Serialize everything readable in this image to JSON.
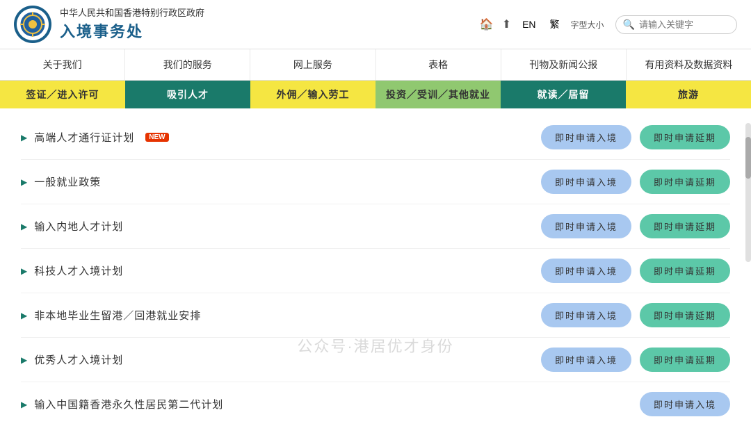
{
  "header": {
    "logo_emoji": "🦁",
    "gov_name": "中华人民共和国香港特别行政区政府",
    "dept_name": "入境事务处",
    "home_icon": "🏠",
    "share_icon": "⬆",
    "lang_en": "EN",
    "lang_tc": "繁",
    "font_size_label": "字型大小",
    "search_placeholder": "请输入关键字"
  },
  "main_nav": {
    "items": [
      {
        "label": "关于我们"
      },
      {
        "label": "我们的服务"
      },
      {
        "label": "网上服务"
      },
      {
        "label": "表格"
      },
      {
        "label": "刊物及新闻公报"
      },
      {
        "label": "有用资料及数据资料"
      }
    ]
  },
  "sub_nav": {
    "items": [
      {
        "label": "签证／进入许可",
        "style": "yellow"
      },
      {
        "label": "吸引人才",
        "style": "teal"
      },
      {
        "label": "外佣／输入劳工",
        "style": "yellow2"
      },
      {
        "label": "投资／受训／其他就业",
        "style": "green"
      },
      {
        "label": "就读／居留",
        "style": "teal2"
      },
      {
        "label": "旅游",
        "style": "yellow3"
      }
    ]
  },
  "content": {
    "items": [
      {
        "label": "高端人才通行证计划",
        "is_new": true,
        "btn_apply": "即时申请入境",
        "btn_extend": "即时申请延期"
      },
      {
        "label": "一般就业政策",
        "is_new": false,
        "btn_apply": "即时申请入境",
        "btn_extend": "即时申请延期"
      },
      {
        "label": "输入内地人才计划",
        "is_new": false,
        "btn_apply": "即时申请入境",
        "btn_extend": "即时申请延期"
      },
      {
        "label": "科技人才入境计划",
        "is_new": false,
        "btn_apply": "即时申请入境",
        "btn_extend": "即时申请延期"
      },
      {
        "label": "非本地毕业生留港／回港就业安排",
        "is_new": false,
        "btn_apply": "即时申请入境",
        "btn_extend": "即时申请延期"
      },
      {
        "label": "优秀人才入境计划",
        "is_new": false,
        "btn_apply": "即时申请入境",
        "btn_extend": "即时申请延期"
      },
      {
        "label": "输入中国籍香港永久性居民第二代计划",
        "is_new": false,
        "btn_apply": "即时申请入境",
        "btn_extend": ""
      }
    ]
  },
  "watermark": {
    "text": "公众号·港居优才身份"
  },
  "new_label": "NEW"
}
